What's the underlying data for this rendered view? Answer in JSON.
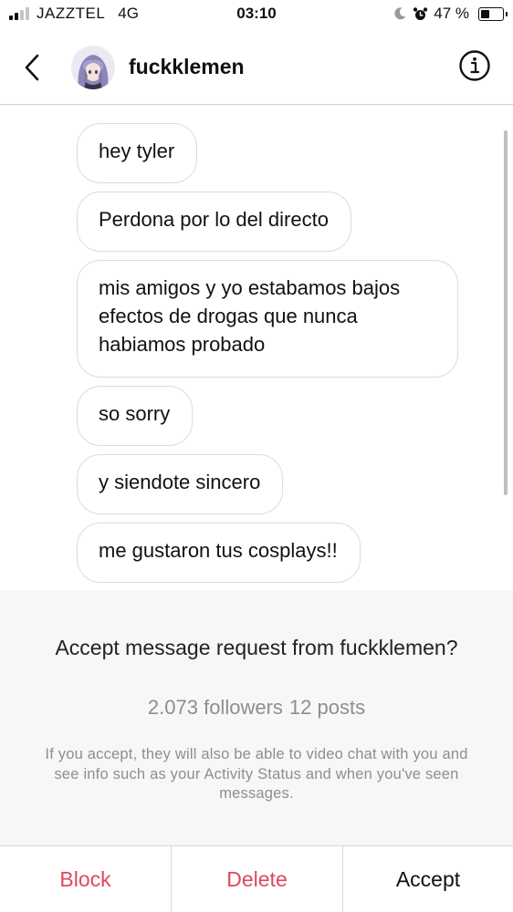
{
  "status_bar": {
    "carrier": "JAZZTEL",
    "network": "4G",
    "time": "03:10",
    "battery_text": "47 %",
    "battery_level": 0.47,
    "signal_bars_active": 2,
    "signal_bars_total": 4,
    "icons": [
      "signal-icon",
      "moon-icon",
      "alarm-icon",
      "battery-icon"
    ]
  },
  "header": {
    "username": "fuckklemen",
    "back_icon": "chevron-left-icon",
    "info_icon": "info-icon"
  },
  "messages": [
    {
      "text": "hey tyler"
    },
    {
      "text": "Perdona por lo del directo"
    },
    {
      "text": "mis amigos y yo estabamos bajos efectos de drogas que nunca habiamos probado"
    },
    {
      "text": "so sorry"
    },
    {
      "text": "y siendote sincero"
    },
    {
      "text": "me gustaron tus cosplays!!"
    }
  ],
  "request": {
    "title": "Accept message request from fuckklemen?",
    "followers": "2.073 followers",
    "posts": "12 posts",
    "note": "If you accept, they will also be able to video chat with you and see info such as your Activity Status and when you've seen messages."
  },
  "actions": {
    "block": "Block",
    "delete": "Delete",
    "accept": "Accept"
  },
  "colors": {
    "destructive": "#e0475b",
    "muted_text": "#8e8e8e",
    "panel_background": "#f7f7f7",
    "bubble_border": "#dcdcdc"
  }
}
